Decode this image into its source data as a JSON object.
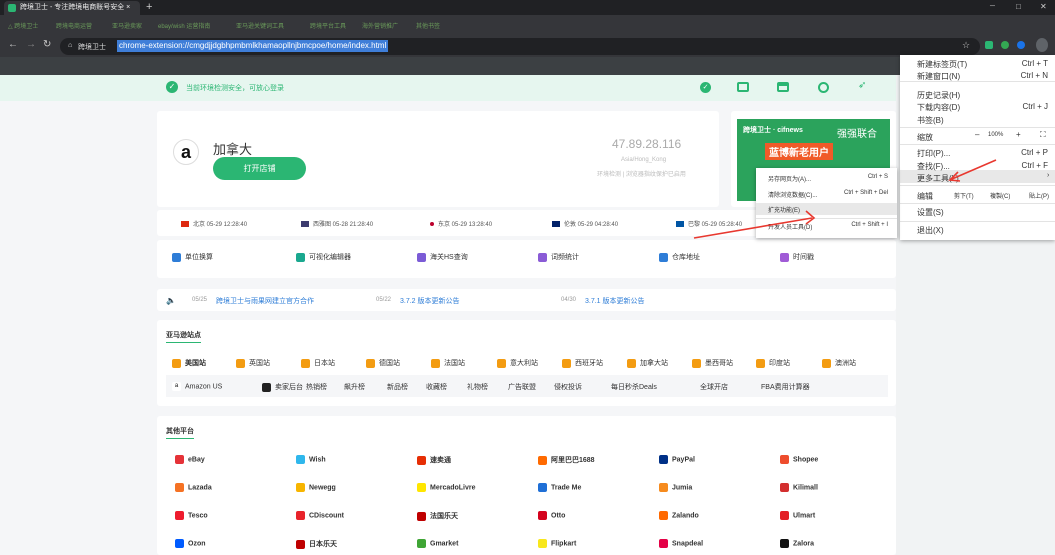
{
  "browser": {
    "tab_title": "跨境卫士 - 专注跨境电商账号安全 ×",
    "new_tab": "+",
    "window_controls": [
      "─",
      "□",
      "✕"
    ],
    "bookmarks": [
      "△ 跨境卫士",
      "跨境电商运营",
      "亚马逊卖家",
      "ebay/wish 运营指南",
      "亚马逊关键词工具",
      "跨境平台工具",
      "海外营销推广",
      "其他书签"
    ],
    "site_label": "跨境卫士",
    "url": "chrome-extension://cmgdjjdgbhpmbmlkhamaopllnjbmcpoe/home/index.html"
  },
  "banner": {
    "text": "当前环境检测安全，可放心登录"
  },
  "store": {
    "name": "加拿大",
    "open_button": "打开店铺",
    "ip": "47.89.28.116",
    "location": "Asia/Hong_Kong",
    "status": "环境检测 | 浏览器指纹保护已启用"
  },
  "ad": {
    "logo": "跨境卫士 · cifnews",
    "slogan": "强强联合",
    "cta": "蓝博新老用户"
  },
  "clocks": [
    {
      "flag": "#de2910",
      "text": "北京 05-29 12:28:40"
    },
    {
      "flag": "#3c3b6e",
      "text": "西雅图 05-28 21:28:40"
    },
    {
      "flag": "#bc002d",
      "text": "东京 05-29 13:28:40"
    },
    {
      "flag": "#012169",
      "text": "伦敦 05-29 04:28:40"
    },
    {
      "flag": "#0055a4",
      "text": "巴黎 05-29 05:28:40"
    }
  ],
  "tools": [
    {
      "label": "单位换算",
      "color": "#2e7dd7"
    },
    {
      "label": "可视化编辑器",
      "color": "#1aa88f"
    },
    {
      "label": "海关HS查询",
      "color": "#7b5bd6"
    },
    {
      "label": "词频统计",
      "color": "#8a5bd6"
    },
    {
      "label": "仓库地址",
      "color": "#2e7dd7"
    },
    {
      "label": "时间戳",
      "color": "#a05bd6"
    }
  ],
  "news": [
    {
      "date": "05/25",
      "text": "跨境卫士与雨果网建立官方合作"
    },
    {
      "date": "05/22",
      "text": "3.7.2 版本更新公告"
    },
    {
      "date": "04/30",
      "text": "3.7.1 版本更新公告"
    }
  ],
  "amazon": {
    "title": "亚马逊站点",
    "sites": [
      "美国站",
      "英国站",
      "日本站",
      "德国站",
      "法国站",
      "意大利站",
      "西班牙站",
      "加拿大站",
      "墨西哥站",
      "印度站",
      "澳洲站"
    ],
    "links": [
      "Amazon US",
      "卖家后台",
      "热销榜",
      "飙升榜",
      "新品榜",
      "收藏榜",
      "礼物榜",
      "广告联盟",
      "侵权投诉",
      "每日秒杀Deals",
      "全球开店",
      "FBA费用计算器"
    ]
  },
  "platforms": {
    "title": "其他平台",
    "items": [
      {
        "label": "eBay",
        "color": "#e53238"
      },
      {
        "label": "Wish",
        "color": "#2fb7ec"
      },
      {
        "label": "速卖通",
        "color": "#e62e04"
      },
      {
        "label": "阿里巴巴1688",
        "color": "#ff6a00"
      },
      {
        "label": "PayPal",
        "color": "#003087"
      },
      {
        "label": "Shopee",
        "color": "#ee4d2d"
      },
      {
        "label": "Lazada",
        "color": "#f57224"
      },
      {
        "label": "Newegg",
        "color": "#f7b500"
      },
      {
        "label": "MercadoLivre",
        "color": "#ffe600"
      },
      {
        "label": "Trade Me",
        "color": "#1f6fd6"
      },
      {
        "label": "Jumia",
        "color": "#f68b1e"
      },
      {
        "label": "Kilimall",
        "color": "#d32f2f"
      },
      {
        "label": "Tesco",
        "color": "#ee1c2e"
      },
      {
        "label": "CDiscount",
        "color": "#e8232a"
      },
      {
        "label": "法国乐天",
        "color": "#bf0000"
      },
      {
        "label": "Otto",
        "color": "#d4021d"
      },
      {
        "label": "Zalando",
        "color": "#ff6900"
      },
      {
        "label": "Ulmart",
        "color": "#e31e24"
      },
      {
        "label": "Ozon",
        "color": "#005bff"
      },
      {
        "label": "日本乐天",
        "color": "#bf0000"
      },
      {
        "label": "Gmarket",
        "color": "#3fa535"
      },
      {
        "label": "Flipkart",
        "color": "#f8e71c"
      },
      {
        "label": "Snapdeal",
        "color": "#e40046"
      },
      {
        "label": "Zalora",
        "color": "#111111"
      }
    ]
  },
  "chrome_menu": [
    {
      "label": "新建标签页(T)",
      "shortcut": "Ctrl + T"
    },
    {
      "label": "新建窗口(N)",
      "shortcut": "Ctrl + N"
    },
    {
      "label": "历史记录(H)",
      "shortcut": ""
    },
    {
      "label": "下载内容(D)",
      "shortcut": "Ctrl + J"
    },
    {
      "label": "书签(B)",
      "shortcut": ""
    },
    {
      "label": "缩放",
      "shortcut": ""
    },
    {
      "label": "打印(P)...",
      "shortcut": "Ctrl + P"
    },
    {
      "label": "查找(F)...",
      "shortcut": "Ctrl + F"
    },
    {
      "label": "更多工具(L)",
      "shortcut": ""
    },
    {
      "label": "编辑",
      "shortcut": ""
    },
    {
      "label": "设置(S)",
      "shortcut": ""
    },
    {
      "label": "退出(X)",
      "shortcut": ""
    }
  ],
  "zoom": {
    "minus": "–",
    "value": "100%",
    "plus": "+",
    "full": "⛶"
  },
  "edit": {
    "cut": "剪下(T)",
    "copy": "複製(C)",
    "paste": "貼上(P)"
  },
  "submenu": [
    {
      "label": "另存网页为(A)...",
      "shortcut": "Ctrl + S"
    },
    {
      "label": "清除浏览数据(C)...",
      "shortcut": "Ctrl + Shift + Del"
    },
    {
      "label": "扩充功能(E)",
      "shortcut": ""
    },
    {
      "label": "开发人员工具(D)",
      "shortcut": "Ctrl + Shift + I"
    }
  ],
  "arrow_color": "#e8382f"
}
